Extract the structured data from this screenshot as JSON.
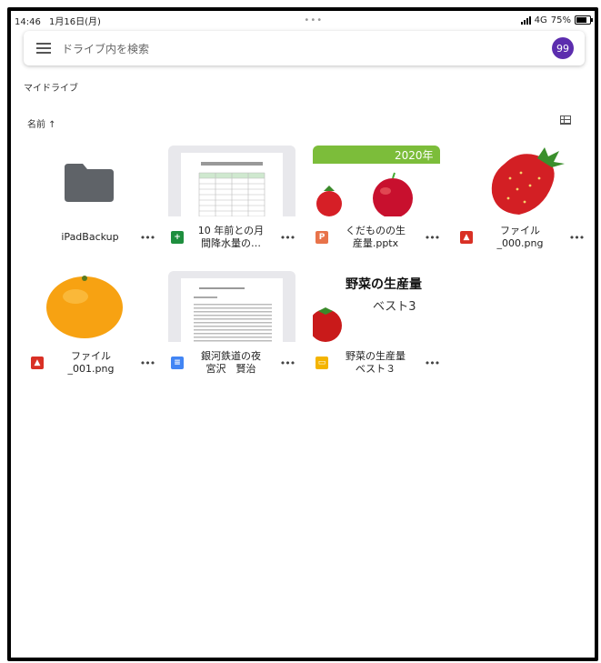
{
  "status": {
    "time": "14:46",
    "date": "1月16日(月)",
    "dots": "•••",
    "network": "4G",
    "battery": "75%"
  },
  "search": {
    "placeholder": "ドライブ内を検索",
    "avatar": "99"
  },
  "section": {
    "title": "マイドライブ",
    "sort": "名前 ↑"
  },
  "files": [
    {
      "name": "iPadBackup",
      "type": "folder"
    },
    {
      "name": "10 年前との月\n間降水量の…",
      "type": "sheet"
    },
    {
      "name": "くだものの生\n産量.pptx",
      "type": "pptx",
      "thumb_text": "2020年"
    },
    {
      "name": "ファイル\n_000.png",
      "type": "image"
    },
    {
      "name": "ファイル\n_001.png",
      "type": "image"
    },
    {
      "name": "銀河鉄道の夜\n宮沢　賢治",
      "type": "doc"
    },
    {
      "name": "野菜の生産量\nベスト３",
      "type": "slides",
      "thumb_title": "野菜の生産量",
      "thumb_sub": "ベスト3"
    }
  ],
  "more_label": "•••",
  "colors": {
    "avatar": "#5c2dae",
    "sheet": "#1e8e3e",
    "pptx": "#e8734a",
    "image": "#d93025",
    "doc": "#4285f4",
    "slides": "#f4b400",
    "folder": "#5f6368"
  }
}
